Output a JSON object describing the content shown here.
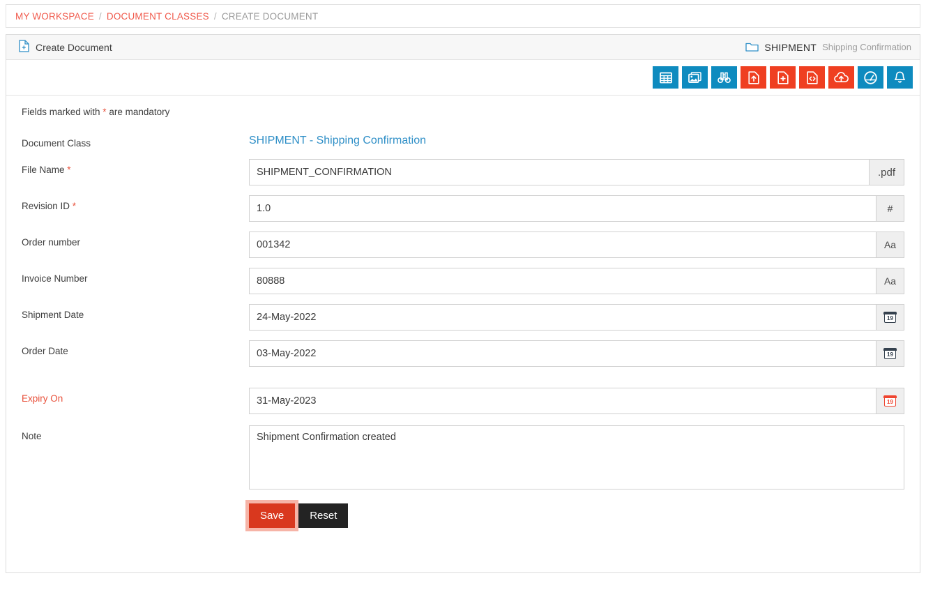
{
  "breadcrumb": {
    "items": [
      {
        "label": "MY WORKSPACE",
        "type": "link"
      },
      {
        "label": "DOCUMENT CLASSES",
        "type": "link"
      },
      {
        "label": "CREATE DOCUMENT",
        "type": "current"
      }
    ],
    "separator": "/"
  },
  "panel": {
    "title": "Create Document",
    "title_icon": "document-add-icon",
    "class_icon": "folder-icon",
    "class_code": "SHIPMENT",
    "class_label": "Shipping Confirmation"
  },
  "toolbar": {
    "buttons": [
      {
        "name": "table-icon",
        "color": "blue"
      },
      {
        "name": "image-icon",
        "color": "blue"
      },
      {
        "name": "binoculars-icon",
        "color": "blue"
      },
      {
        "name": "file-upload-icon",
        "color": "red"
      },
      {
        "name": "file-add-icon",
        "color": "red"
      },
      {
        "name": "file-code-icon",
        "color": "red"
      },
      {
        "name": "cloud-upload-icon",
        "color": "red"
      },
      {
        "name": "dashboard-icon",
        "color": "blue"
      },
      {
        "name": "bell-icon",
        "color": "blue"
      }
    ]
  },
  "form": {
    "mandatory_note_prefix": "Fields marked with ",
    "mandatory_note_star": "*",
    "mandatory_note_suffix": " are mandatory",
    "document_class": {
      "label": "Document Class",
      "value": "SHIPMENT - Shipping Confirmation"
    },
    "fields": [
      {
        "label": "File Name",
        "required": true,
        "value": "SHIPMENT_CONFIRMATION",
        "placeholder": "File Name",
        "addon": ".pdf",
        "addon_name": "file-extension-addon"
      },
      {
        "label": "Revision ID",
        "required": true,
        "value": "1.0",
        "placeholder": "Revision ID",
        "addon": "#",
        "addon_name": "number-addon"
      },
      {
        "label": "Order number",
        "required": false,
        "value": "001342",
        "placeholder": "Order number",
        "addon": "Aa",
        "addon_name": "text-addon"
      },
      {
        "label": "Invoice Number",
        "required": false,
        "value": "80888",
        "placeholder": "Invoice Number",
        "addon": "Aa",
        "addon_name": "text-addon"
      },
      {
        "label": "Shipment Date",
        "required": false,
        "value": "24-May-2022",
        "placeholder": "Shipment Date",
        "addon": "19",
        "addon_name": "calendar-icon"
      },
      {
        "label": "Order Date",
        "required": false,
        "value": "03-May-2022",
        "placeholder": "Order Date",
        "addon": "19",
        "addon_name": "calendar-icon"
      },
      {
        "label": "Expiry On",
        "required": false,
        "value": "31-May-2023",
        "placeholder": "Expiry On",
        "addon": "19",
        "addon_name": "calendar-icon"
      }
    ],
    "note": {
      "label": "Note",
      "value": "Shipment Confirmation created",
      "placeholder": "Note"
    },
    "buttons": {
      "save": "Save",
      "reset": "Reset"
    }
  },
  "colors": {
    "accent_red": "#ef3f21",
    "accent_blue": "#0e8bbf",
    "link_red": "#f05a4c",
    "link_blue": "#2f8fc7",
    "save_red": "#d9381e",
    "reset_dark": "#232323"
  }
}
